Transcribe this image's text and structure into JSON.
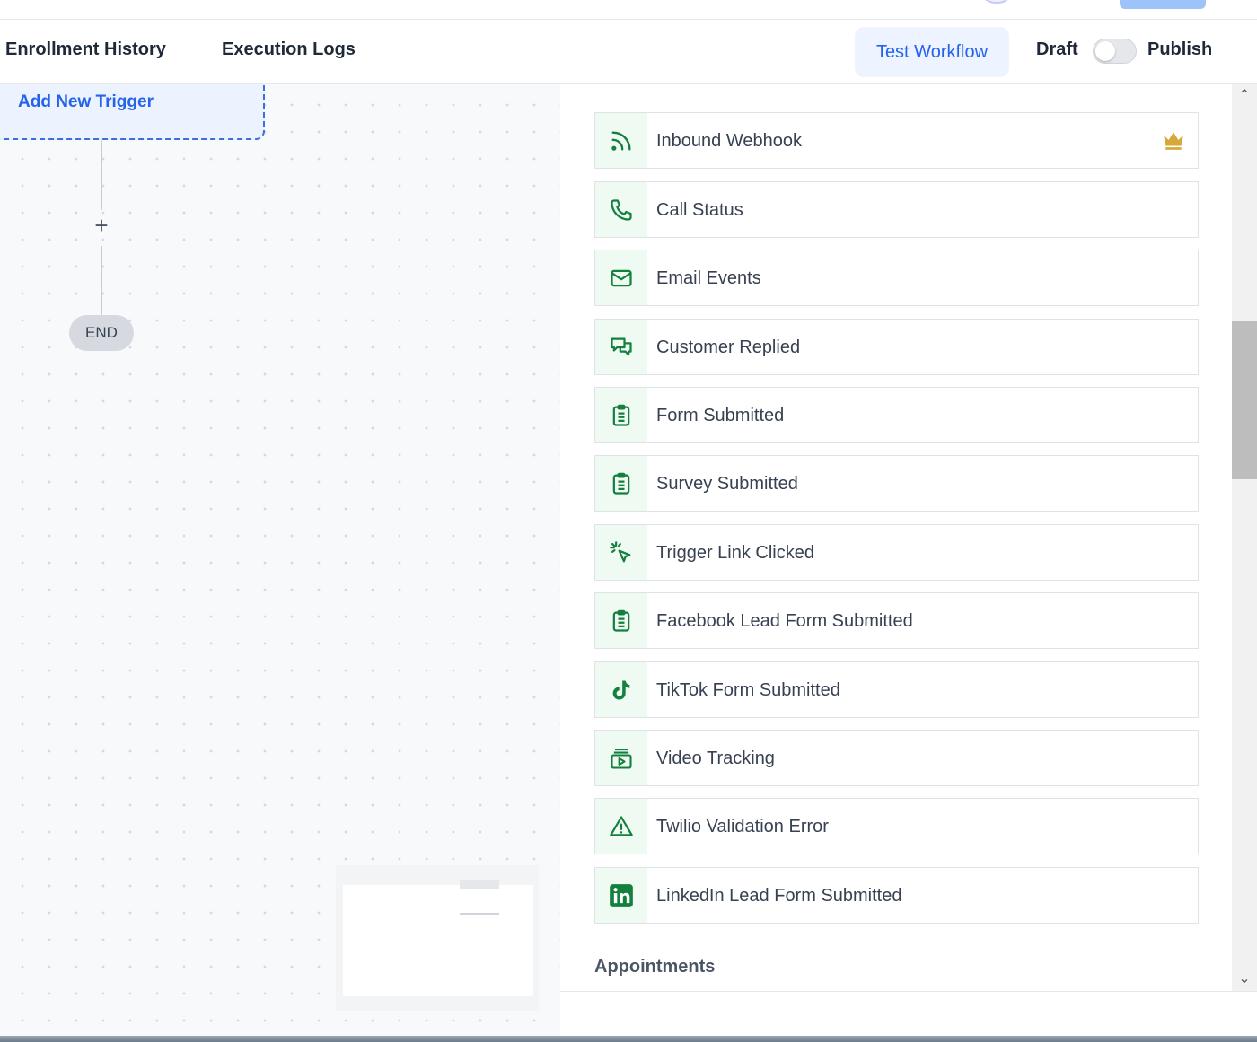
{
  "header": {
    "tabs": [
      "Enrollment History",
      "Execution Logs"
    ],
    "test_workflow_label": "Test Workflow",
    "draft_label": "Draft",
    "publish_label": "Publish",
    "published": false
  },
  "canvas": {
    "trigger_label": "Add New Trigger",
    "add_step_symbol": "+",
    "end_label": "END"
  },
  "panel": {
    "triggers": [
      {
        "label": "Inbound Webhook",
        "icon": "webhook-icon",
        "premium": true
      },
      {
        "label": "Call Status",
        "icon": "phone-icon"
      },
      {
        "label": "Email Events",
        "icon": "mail-icon"
      },
      {
        "label": "Customer Replied",
        "icon": "chat-icon"
      },
      {
        "label": "Form Submitted",
        "icon": "clipboard-icon"
      },
      {
        "label": "Survey Submitted",
        "icon": "clipboard-icon"
      },
      {
        "label": "Trigger Link Clicked",
        "icon": "cursor-click-icon"
      },
      {
        "label": "Facebook Lead Form Submitted",
        "icon": "clipboard-icon"
      },
      {
        "label": "TikTok Form Submitted",
        "icon": "tiktok-icon"
      },
      {
        "label": "Video Tracking",
        "icon": "video-icon"
      },
      {
        "label": "Twilio Validation Error",
        "icon": "warning-icon"
      },
      {
        "label": "LinkedIn Lead Form Submitted",
        "icon": "linkedin-icon"
      }
    ],
    "next_section_title": "Appointments"
  },
  "colors": {
    "accent_blue": "#2563eb",
    "icon_green": "#13803d",
    "icon_bg": "#eefaf2",
    "premium_gold": "#d4a93a"
  }
}
